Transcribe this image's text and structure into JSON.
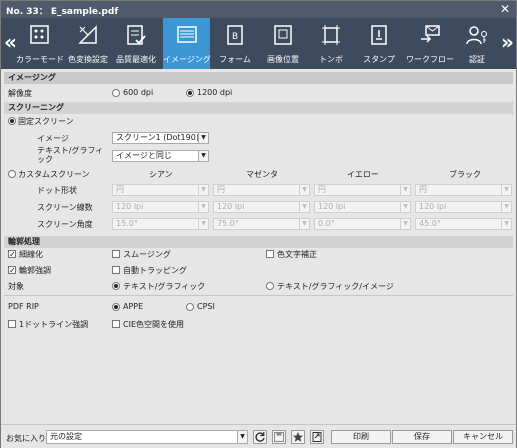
{
  "window": {
    "title": "No. 33： E_sample.pdf",
    "close_label": "✕"
  },
  "toolbar": {
    "nav_left": "«",
    "nav_right": "»",
    "items": [
      {
        "label": "カラーモード",
        "icon": "palette-icon"
      },
      {
        "label": "色変換設定",
        "icon": "color-wheel-icon"
      },
      {
        "label": "品質最適化",
        "icon": "checklist-icon"
      },
      {
        "label": "イメージング",
        "icon": "imaging-icon",
        "active": true
      },
      {
        "label": "フォーム",
        "icon": "form-icon"
      },
      {
        "label": "画像位置",
        "icon": "position-icon"
      },
      {
        "label": "トンボ",
        "icon": "crop-marks-icon"
      },
      {
        "label": "スタンプ",
        "icon": "stamp-icon"
      },
      {
        "label": "ワークフロー",
        "icon": "workflow-icon"
      },
      {
        "label": "認証",
        "icon": "auth-icon"
      }
    ]
  },
  "imaging": {
    "header": "イメージング",
    "resolution_label": "解像度",
    "res_600": "600 dpi",
    "res_1200": "1200 dpi",
    "selected_resolution": "1200 dpi"
  },
  "screening": {
    "header": "スクリーニング",
    "fixed_label": "固定スクリーン",
    "image_label": "イメージ",
    "image_value": "スクリーン1 (Dot190)",
    "text_graphic_label": "テキスト/グラフィック",
    "text_graphic_value": "イメージと同じ",
    "custom_label": "カスタムスクリーン",
    "columns": [
      "シアン",
      "マゼンタ",
      "イエロー",
      "ブラック"
    ],
    "dot_shape_label": "ドット形状",
    "dot_shape_values": [
      "円",
      "円",
      "円",
      "円"
    ],
    "lines_label": "スクリーン線数",
    "lines_values": [
      "120 lpi",
      "120 lpi",
      "120 lpi",
      "120 lpi"
    ],
    "angle_label": "スクリーン角度",
    "angle_values": [
      "15.0°",
      "75.0°",
      "0.0°",
      "45.0°"
    ]
  },
  "edge": {
    "header": "輪郭処理",
    "thinning": "細線化",
    "smoothing": "スムージング",
    "color_text": "色文字補正",
    "edge_enhance": "輪郭強調",
    "auto_trapping": "自動トラッピング",
    "target_label": "対象",
    "target_text_graphic": "テキスト/グラフィック",
    "target_all": "テキスト/グラフィック/イメージ"
  },
  "pdf": {
    "rip_label": "PDF RIP",
    "appe": "APPE",
    "cpsi": "CPSI",
    "one_dot": "1ドットライン強調",
    "cie": "CIE色空間を使用"
  },
  "footer": {
    "favorites_label": "お気に入り",
    "favorites_value": "元の設定",
    "print": "印刷",
    "save": "保存",
    "cancel": "キャンセル"
  }
}
